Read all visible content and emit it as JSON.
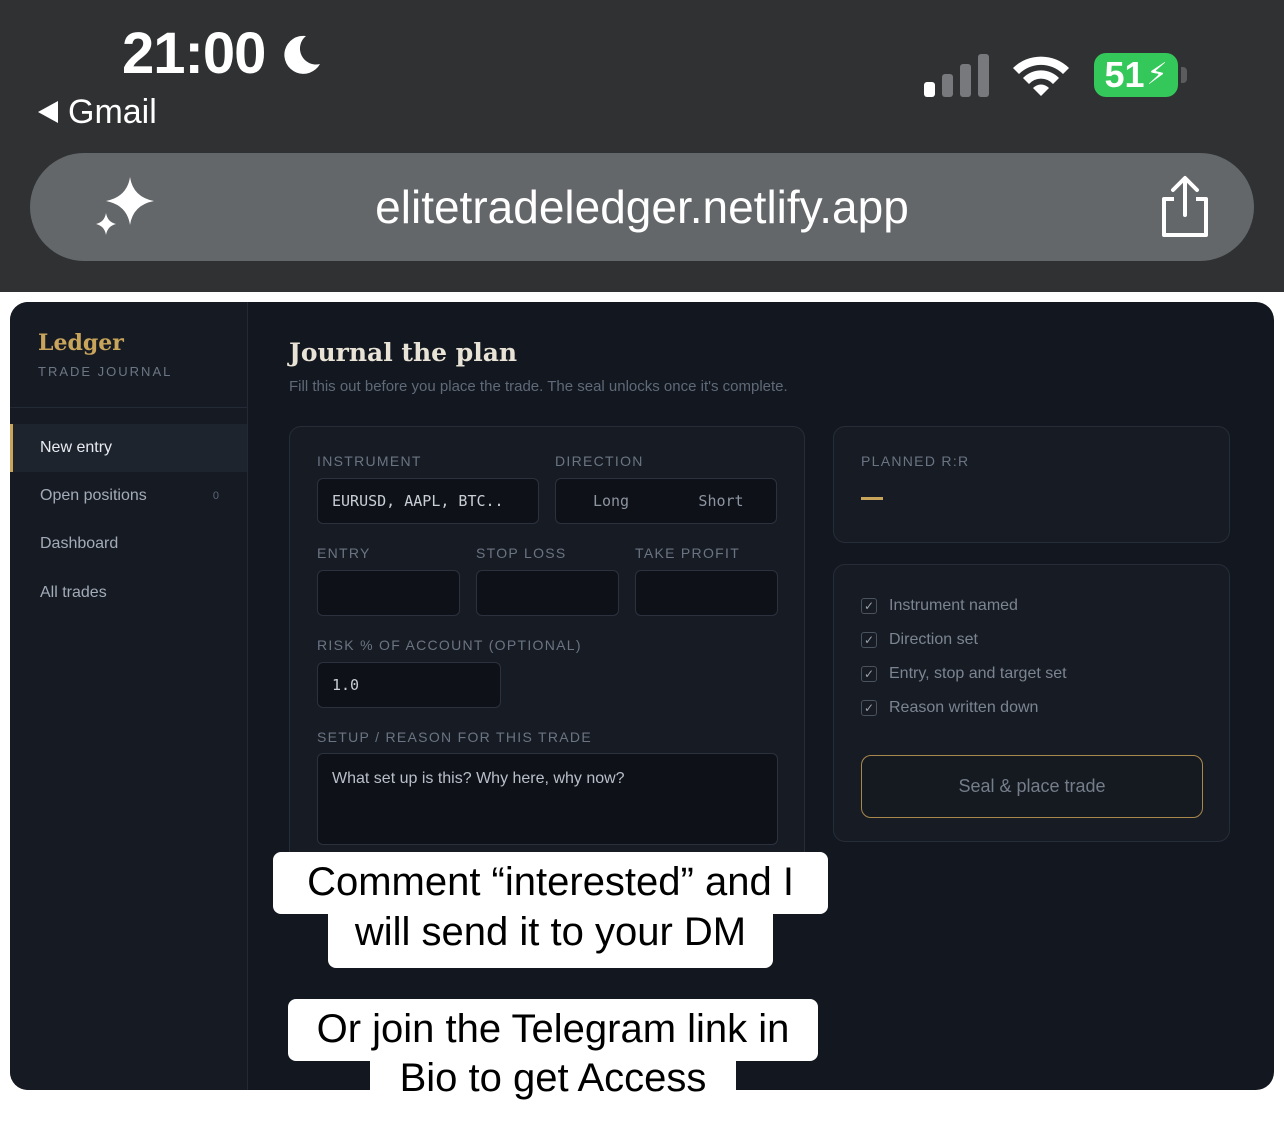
{
  "status_bar": {
    "time": "21:00",
    "back_app": "Gmail",
    "battery_level": "51",
    "colors": {
      "battery": "#34c759"
    }
  },
  "browser": {
    "url": "elitetradeledger.netlify.app"
  },
  "sidebar": {
    "brand": "Ledger",
    "brand_sub": "TRADE JOURNAL",
    "items": [
      {
        "label": "New entry",
        "active": true
      },
      {
        "label": "Open positions",
        "count": "0"
      },
      {
        "label": "Dashboard"
      },
      {
        "label": "All trades"
      }
    ]
  },
  "page": {
    "title": "Journal the plan",
    "subtitle": "Fill this out before you place the trade. The seal unlocks once it's complete."
  },
  "form": {
    "instrument_label": "INSTRUMENT",
    "instrument_placeholder": "EURUSD, AAPL, BTC..",
    "direction_label": "DIRECTION",
    "direction_options": [
      "Long",
      "Short"
    ],
    "entry_label": "ENTRY",
    "stop_loss_label": "STOP LOSS",
    "take_profit_label": "TAKE PROFIT",
    "risk_label": "RISK % OF ACCOUNT (OPTIONAL)",
    "risk_value": "1.0",
    "setup_label": "SETUP / REASON FOR THIS TRADE",
    "setup_placeholder": "What set up is this? Why here, why now?"
  },
  "summary": {
    "rr_label": "PLANNED R:R",
    "checklist": [
      "Instrument named",
      "Direction set",
      "Entry, stop and target set",
      "Reason written down"
    ],
    "seal_button": "Seal & place trade",
    "accent": "#c9a55c"
  },
  "captions": {
    "line1a": "Comment “interested” and I",
    "line1b": "will send it to your DM",
    "line2a": "Or join the Telegram link in",
    "line2b": "Bio to get Access"
  }
}
